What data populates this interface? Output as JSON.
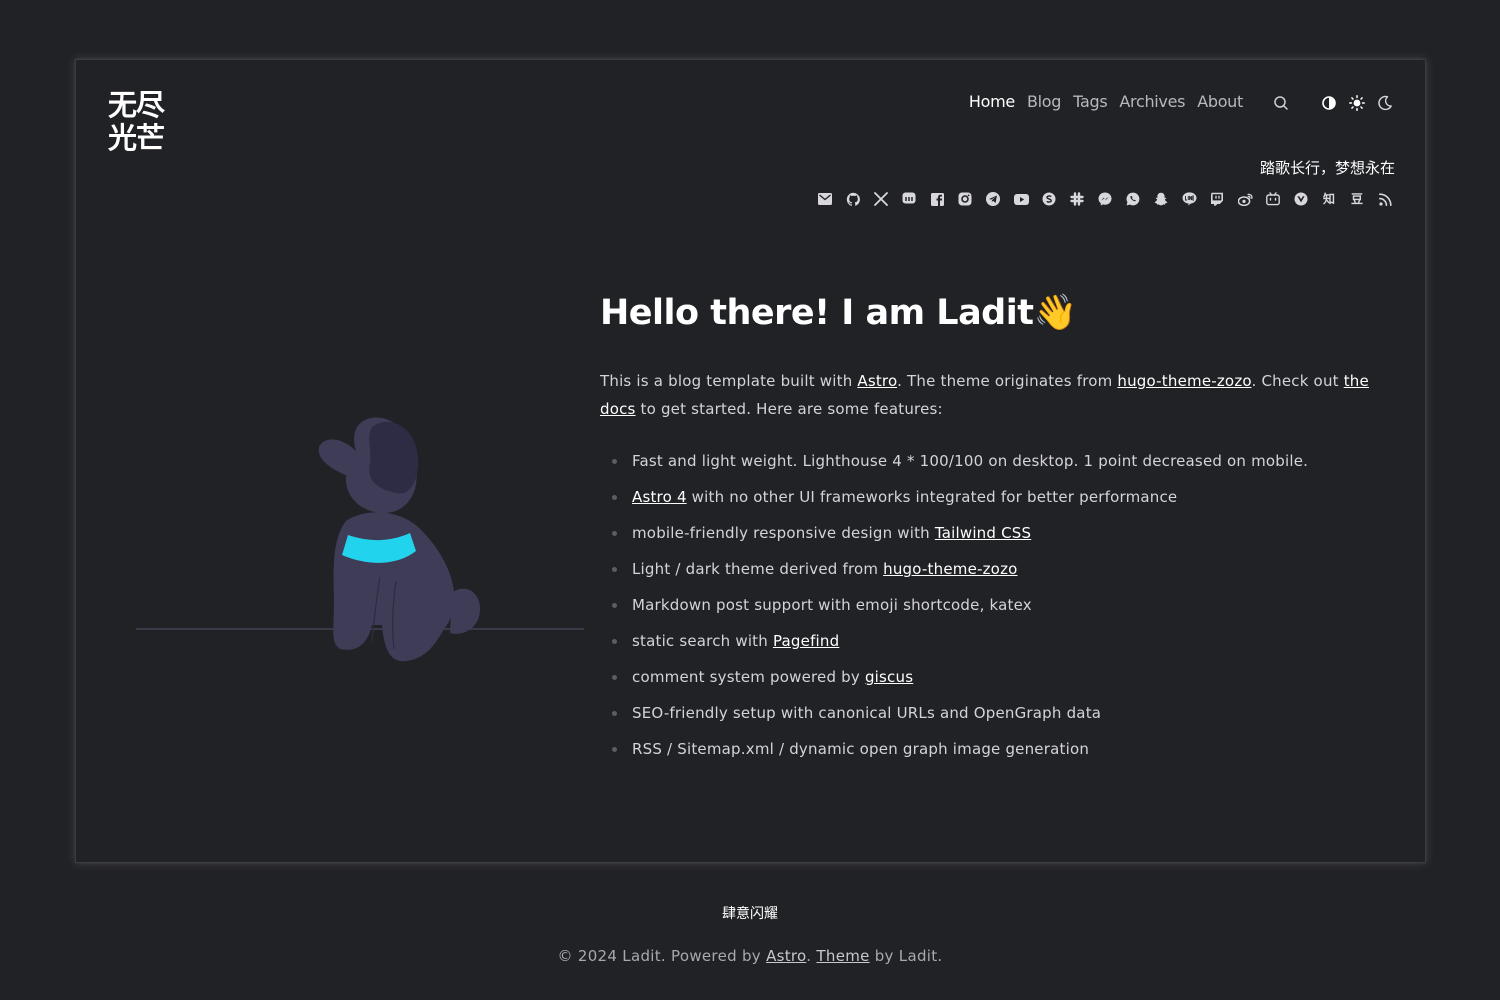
{
  "site": {
    "logo_line1": "无尽",
    "logo_line2": "光芒",
    "motto": "踏歌长行，梦想永在",
    "footer_tagline": "肆意闪耀"
  },
  "nav": {
    "items": [
      {
        "label": "Home",
        "active": true
      },
      {
        "label": "Blog"
      },
      {
        "label": "Tags"
      },
      {
        "label": "Archives"
      },
      {
        "label": "About"
      }
    ],
    "icons": [
      "search-icon",
      "contrast-icon",
      "sun-icon",
      "moon-icon"
    ]
  },
  "socials": [
    "email-icon",
    "github-icon",
    "x-icon",
    "mastodon-icon",
    "facebook-icon",
    "instagram-icon",
    "telegram-icon",
    "youtube-icon",
    "skype-icon",
    "slack-icon",
    "messenger-icon",
    "whatsapp-icon",
    "snapchat-icon",
    "line-icon",
    "twitch-icon",
    "weibo-icon",
    "bilibili-icon",
    "vuejs-icon",
    "zhihu-icon",
    "douban-icon",
    "rss-icon"
  ],
  "social_glyphs": {
    "zhihu": "知",
    "douban": "豆"
  },
  "hero": {
    "title": "Hello there! I am Ladit",
    "wave": "👋",
    "intro": {
      "t1": "This is a blog template built with ",
      "l1": "Astro",
      "t2": ". The theme originates from ",
      "l2": "hugo-theme-zozo",
      "t3": ". Check out ",
      "l3": "the docs",
      "t4": " to get started. Here are some features:"
    }
  },
  "features": [
    {
      "pre": "Fast and light weight. Lighthouse 4 * 100/100 on desktop. 1 point decreased on mobile.",
      "link": "",
      "post": ""
    },
    {
      "pre": "",
      "link": "Astro 4",
      "post": " with no other UI frameworks integrated for better performance"
    },
    {
      "pre": "mobile-friendly responsive design with ",
      "link": "Tailwind CSS",
      "post": ""
    },
    {
      "pre": "Light / dark theme derived from ",
      "link": "hugo-theme-zozo",
      "post": ""
    },
    {
      "pre": "Markdown post support with emoji shortcode, katex",
      "link": "",
      "post": ""
    },
    {
      "pre": "static search with ",
      "link": "Pagefind",
      "post": ""
    },
    {
      "pre": "comment system powered by ",
      "link": "giscus",
      "post": ""
    },
    {
      "pre": "SEO-friendly setup with canonical URLs and OpenGraph data",
      "link": "",
      "post": ""
    },
    {
      "pre": "RSS / Sitemap.xml / dynamic open graph image generation",
      "link": "",
      "post": ""
    }
  ],
  "footer": {
    "copyright": "© 2024 Ladit. Powered by ",
    "astro": "Astro",
    "sep": ". ",
    "theme": "Theme",
    "by": " by Ladit."
  },
  "colors": {
    "background": "#212226",
    "dog_body": "#3f3c58",
    "dog_ear": "#2e2b44",
    "collar": "#22d3ee"
  }
}
